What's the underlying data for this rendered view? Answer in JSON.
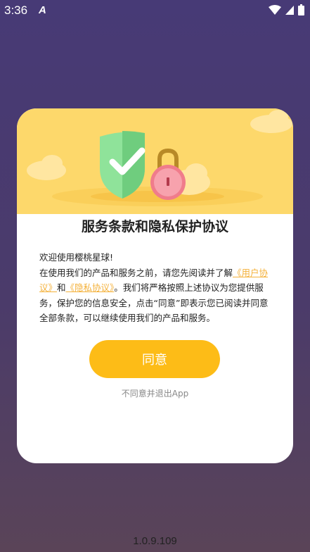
{
  "status_bar": {
    "time": "3:36",
    "app_icon": "A",
    "icons": [
      "wifi-icon",
      "signal-icon",
      "battery-icon"
    ]
  },
  "dialog": {
    "title": "服务条款和隐私保护协议",
    "welcome": "欢迎使用樱桃星球!",
    "body_prefix": "在使用我们的产品和服务之前，请您先阅读并了解",
    "user_agreement": "《用户协议》",
    "and": "和",
    "privacy_policy": "《隐私协议》",
    "body_suffix": "。我们将严格按照上述协议为您提供服务，保护您的信息安全，点击“同意”即表示您已阅读并同意全部条款，可以继续使用我们的产品和服务。",
    "agree_button": "同意",
    "decline_link": "不同意并退出App"
  },
  "version": "1.0.9.109",
  "colors": {
    "header": "#fdd86b",
    "accent": "#fdbc17",
    "link": "#f4b13a",
    "background": "#473a76"
  }
}
